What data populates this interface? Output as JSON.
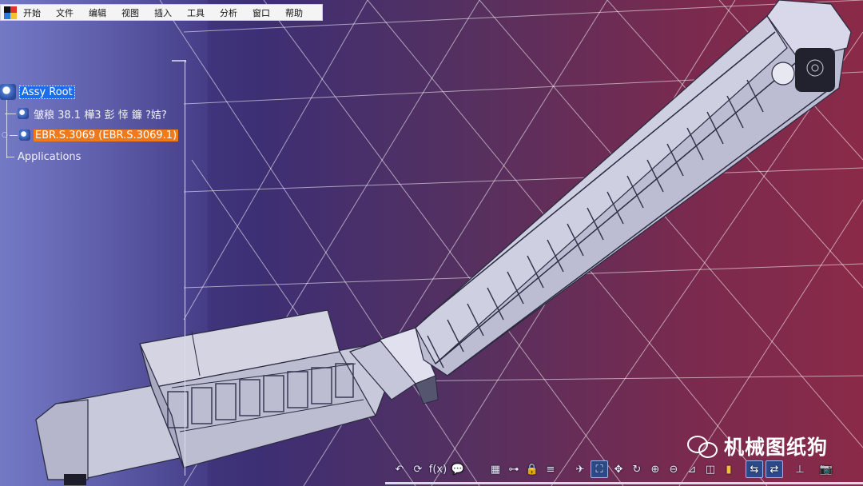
{
  "menu": {
    "items": [
      "开始",
      "文件",
      "编辑",
      "视图",
      "插入",
      "工具",
      "分析",
      "窗口",
      "帮助"
    ]
  },
  "tree": {
    "root": "Assy Root",
    "item1": "皱稂 38.1 樺3 彭 悻  鐮  ?姞?",
    "item2": "EBR.S.3069 (EBR.S.3069.1)",
    "applications": "Applications"
  },
  "toolbar": {
    "icons": [
      "undo-icon",
      "redo-icon",
      "formula-icon",
      "comment-icon",
      "grid-icon",
      "tree-icon",
      "lock-icon",
      "layers-icon",
      "fly-mode-icon",
      "fit-all-icon",
      "pan-icon",
      "rotate-icon",
      "zoom-in-icon",
      "zoom-out-icon",
      "normal-view-icon",
      "view-box-icon",
      "render-style-icon",
      "hide-show-icon",
      "swap-visible-icon",
      "axis-icon",
      "snapshot-icon"
    ]
  },
  "watermark": {
    "text": "机械图纸狗",
    "logo": "wechat-logo"
  },
  "colors": {
    "selection": "#f07a1a",
    "root_highlight": "#1c6ee8"
  }
}
